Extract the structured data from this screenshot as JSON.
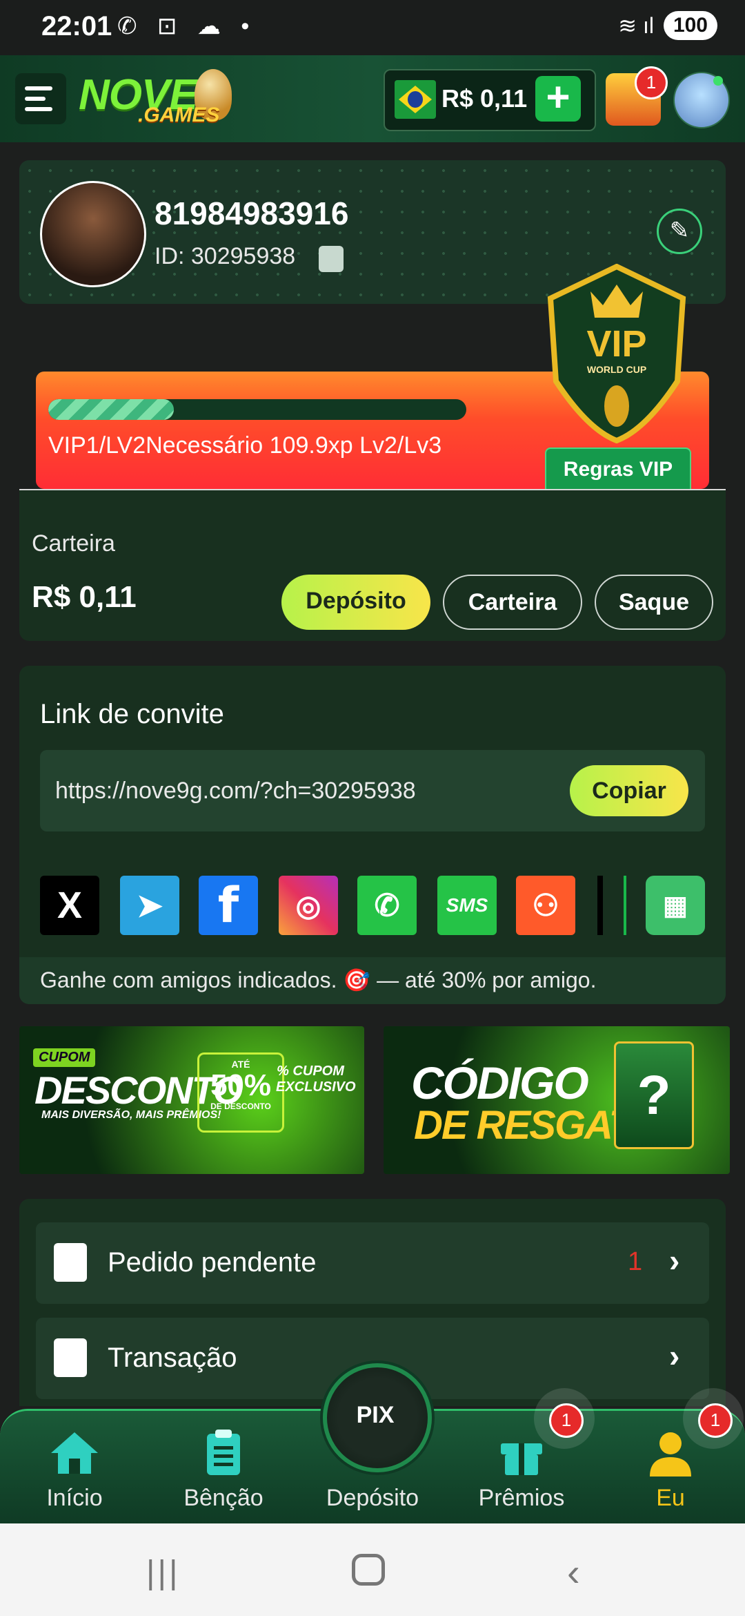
{
  "status_bar": {
    "time": "22:01",
    "icons": "✆ ⊡ ☁ •",
    "signal": "≋ ıl",
    "battery": "100"
  },
  "header": {
    "logo_main": "NOVE",
    "logo_sub": ".GAMES",
    "balance": "R$ 0,11",
    "add_label": "+",
    "chest_badge": "1"
  },
  "profile": {
    "name": "81984983916",
    "id_label": "ID: 30295938"
  },
  "vip": {
    "progress": 0.3,
    "text": "VIP1/LV2Necessário 109.9xp Lv2/Lv3",
    "rules_label": "Regras VIP",
    "badge_title": "VIP",
    "badge_sub": "WORLD CUP"
  },
  "wallet": {
    "label": "Carteira",
    "amount": "R$ 0,11",
    "deposit": "Depósito",
    "wallet": "Carteira",
    "withdraw": "Saque"
  },
  "invite": {
    "title": "Link de convite",
    "link": "https://nove9g.com/?ch=30295938",
    "copy": "Copiar",
    "footer": "Ganhe com amigos indicados. 🎯 — até 30% por amigo.",
    "share": {
      "x": "X",
      "telegram": "➤",
      "facebook": "f",
      "instagram": "◎",
      "whatsapp": "✆",
      "sms": "SMS",
      "kwai": "⚇",
      "more": "▦"
    }
  },
  "banners": {
    "left": {
      "tag": "CUPOM",
      "title": "DESCONTO",
      "sub": "MAIS DIVERSÃO, MAIS PRÊMIOS!",
      "ate": "ATÉ",
      "pct": "50%",
      "pct_sub": "DE DESCONTO",
      "cupom": "% CUPOM EXCLUSIVO"
    },
    "right": {
      "title1": "CÓDIGO",
      "title2": "DE RESGATE",
      "gift": "?"
    }
  },
  "menu": {
    "items": [
      {
        "label": "Pedido pendente",
        "count": "1",
        "chevron": "›"
      },
      {
        "label": "Transação",
        "count": "",
        "chevron": "›"
      }
    ]
  },
  "bottom_nav": {
    "home": "Início",
    "bless": "Bênção",
    "deposit": "Depósito",
    "deposit_icon": "PIX",
    "prizes": "Prêmios",
    "me": "Eu",
    "prizes_badge": "1",
    "me_badge": "1",
    "active_color": "#f5c518"
  },
  "android": {
    "recent": "|||",
    "back": "‹"
  }
}
